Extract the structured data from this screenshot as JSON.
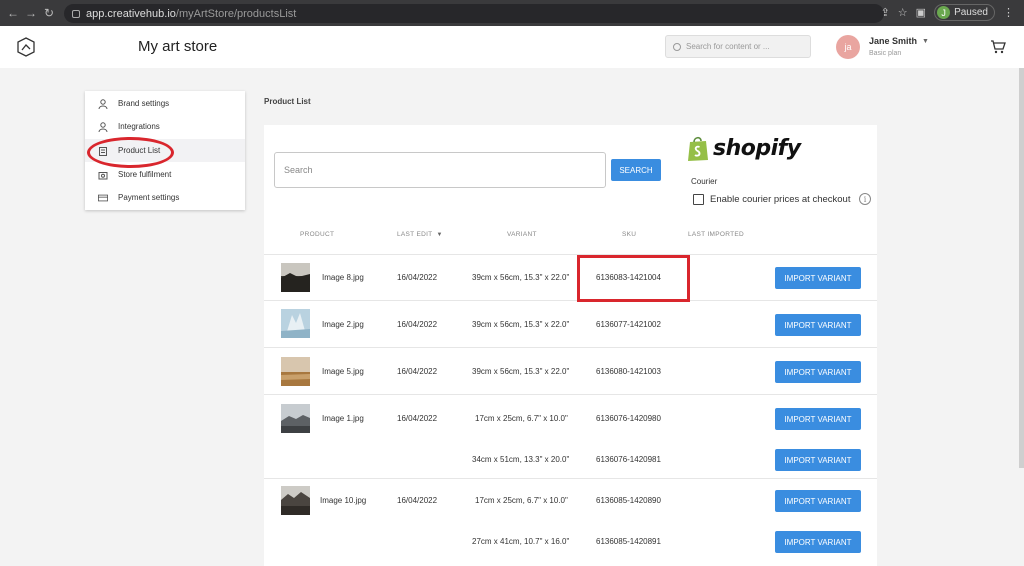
{
  "browser": {
    "url_domain": "app.creativehub.io",
    "url_path": "/myArtStore/productsList",
    "profile_initial": "J",
    "profile_status": "Paused"
  },
  "header": {
    "title": "My art store",
    "search_placeholder": "Search for content or ...",
    "user_initials": "ja",
    "user_name": "Jane Smith",
    "user_plan": "Basic plan"
  },
  "sidebar": {
    "items": [
      {
        "label": "Brand settings",
        "icon": "user-icon"
      },
      {
        "label": "Integrations",
        "icon": "user-icon"
      },
      {
        "label": "Product List",
        "icon": "clipboard-icon",
        "active": true
      },
      {
        "label": "Store fulfilment",
        "icon": "box-icon"
      },
      {
        "label": "Payment settings",
        "icon": "card-icon"
      }
    ]
  },
  "main": {
    "breadcrumb": "Product List",
    "search_placeholder": "Search",
    "search_button": "SEARCH",
    "shopify_word": "shopify",
    "courier_label": "Courier",
    "courier_checkbox_label": "Enable courier prices at checkout",
    "courier_checked": false,
    "info_glyph": "i",
    "columns": [
      "PRODUCT",
      "LAST EDIT",
      "VARIANT",
      "SKU",
      "LAST IMPORTED"
    ],
    "sort_glyph": "▼",
    "import_label": "IMPORT VARIANT",
    "rows": [
      {
        "product": "Image 8.jpg",
        "last_edit": "16/04/2022",
        "variant": "39cm x 56cm, 15.3\" x 22.0\"",
        "sku": "6136083-1421004"
      },
      {
        "product": "Image 2.jpg",
        "last_edit": "16/04/2022",
        "variant": "39cm x 56cm, 15.3\" x 22.0\"",
        "sku": "6136077-1421002"
      },
      {
        "product": "Image 5.jpg",
        "last_edit": "16/04/2022",
        "variant": "39cm x 56cm, 15.3\" x 22.0\"",
        "sku": "6136080-1421003"
      },
      {
        "product": "Image 1.jpg",
        "last_edit": "16/04/2022",
        "variant": "17cm x 25cm, 6.7\" x 10.0\"",
        "sku": "6136076-1420980"
      },
      {
        "product": "",
        "last_edit": "",
        "variant": "34cm x 51cm, 13.3\" x 20.0\"",
        "sku": "6136076-1420981"
      },
      {
        "product": "Image 10.jpg",
        "last_edit": "16/04/2022",
        "variant": "17cm x 25cm, 6.7\" x 10.0\"",
        "sku": "6136085-1420890"
      },
      {
        "product": "",
        "last_edit": "",
        "variant": "27cm x 41cm, 10.7\" x 16.0\"",
        "sku": "6136085-1420891"
      }
    ]
  },
  "colors": {
    "accent": "#3a8de0",
    "highlight": "#d9262d",
    "shopify_green": "#95bf47"
  }
}
